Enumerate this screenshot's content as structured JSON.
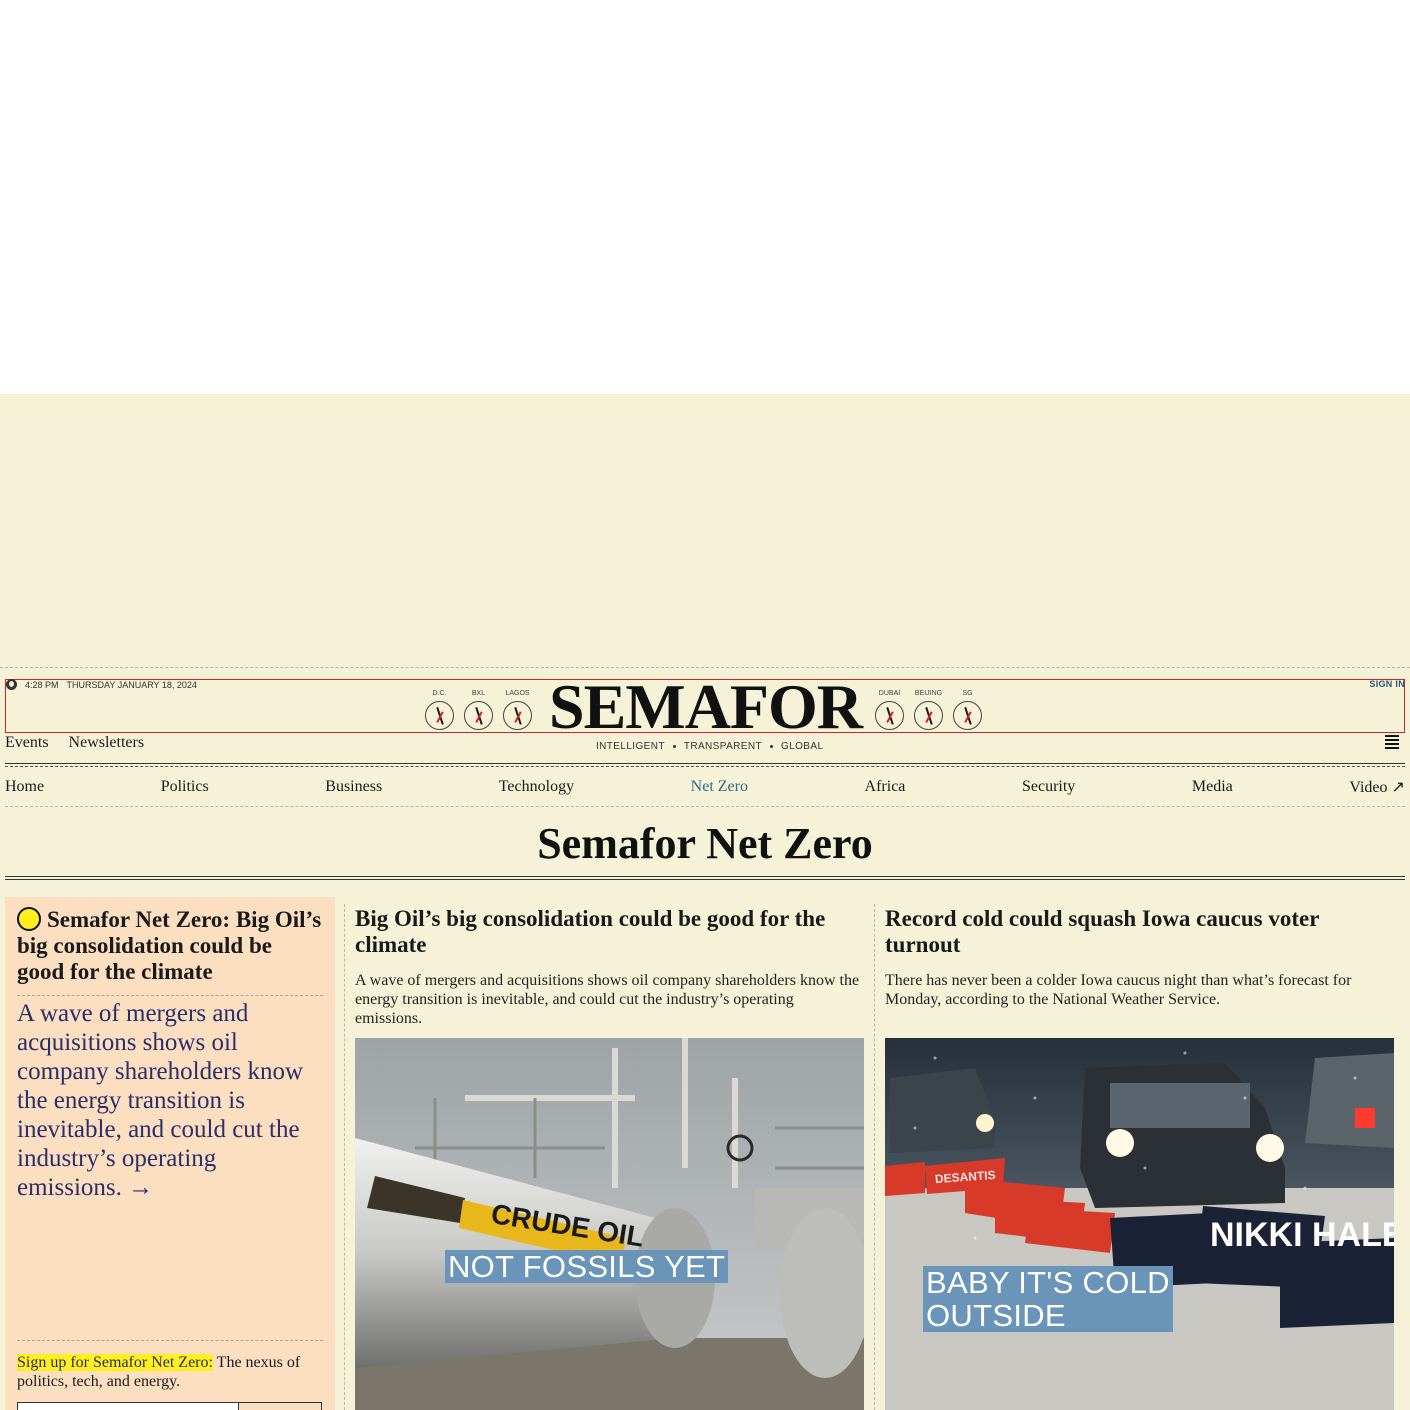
{
  "utility": {
    "time": "4:28 PM",
    "date": "THURSDAY JANUARY 18, 2024",
    "sign_in": "SIGN IN"
  },
  "clocks_left": [
    "D.C.",
    "BXL",
    "LAGOS"
  ],
  "clocks_right": [
    "DUBAI",
    "BEIJING",
    "SG"
  ],
  "logo": "SEMAFOR",
  "tagline": [
    "INTELLIGENT",
    "TRANSPARENT",
    "GLOBAL"
  ],
  "sub_links": [
    "Events",
    "Newsletters"
  ],
  "nav": [
    {
      "label": "Home"
    },
    {
      "label": "Politics"
    },
    {
      "label": "Business"
    },
    {
      "label": "Technology"
    },
    {
      "label": "Net Zero",
      "active": true
    },
    {
      "label": "Africa"
    },
    {
      "label": "Security"
    },
    {
      "label": "Media"
    },
    {
      "label": "Video ↗"
    }
  ],
  "section_title": "Semafor Net Zero",
  "promo": {
    "headline": "Semafor Net Zero: Big Oil’s big consolidation could be good for the climate",
    "dek": "A wave of mergers and acquisitions shows oil company shareholders know the energy transition is inevitable, and could cut the industry’s operating emissions. →",
    "signup_link": "Sign up for Semafor Net Zero:",
    "signup_text": " The nexus of politics, tech, and energy."
  },
  "stories": [
    {
      "headline": "Big Oil’s big consolidation could be good for the climate",
      "dek": "A wave of mergers and acquisitions shows oil company shareholders know the energy transition is inevitable, and could cut the industry’s operating emissions.",
      "image_caption": "NOT FOSSILS YET",
      "image_text": "CRUDE OIL"
    },
    {
      "headline": "Record cold could squash Iowa caucus voter turnout",
      "dek": "There has never been a colder Iowa caucus night than what’s forecast for Monday, according to the National Weather Service.",
      "image_caption": "BABY IT'S COLD OUTSIDE",
      "image_signs": [
        "DESANTIS",
        "NIKKI HALEY"
      ]
    }
  ],
  "colors": {
    "background": "#f5f2d7",
    "promo_bg": "#fcdfc0",
    "highlight": "#ffef1f",
    "accent_blue": "#2f6a84",
    "caption_bg": "#6b95b8",
    "masthead_outline": "#d2232a"
  }
}
